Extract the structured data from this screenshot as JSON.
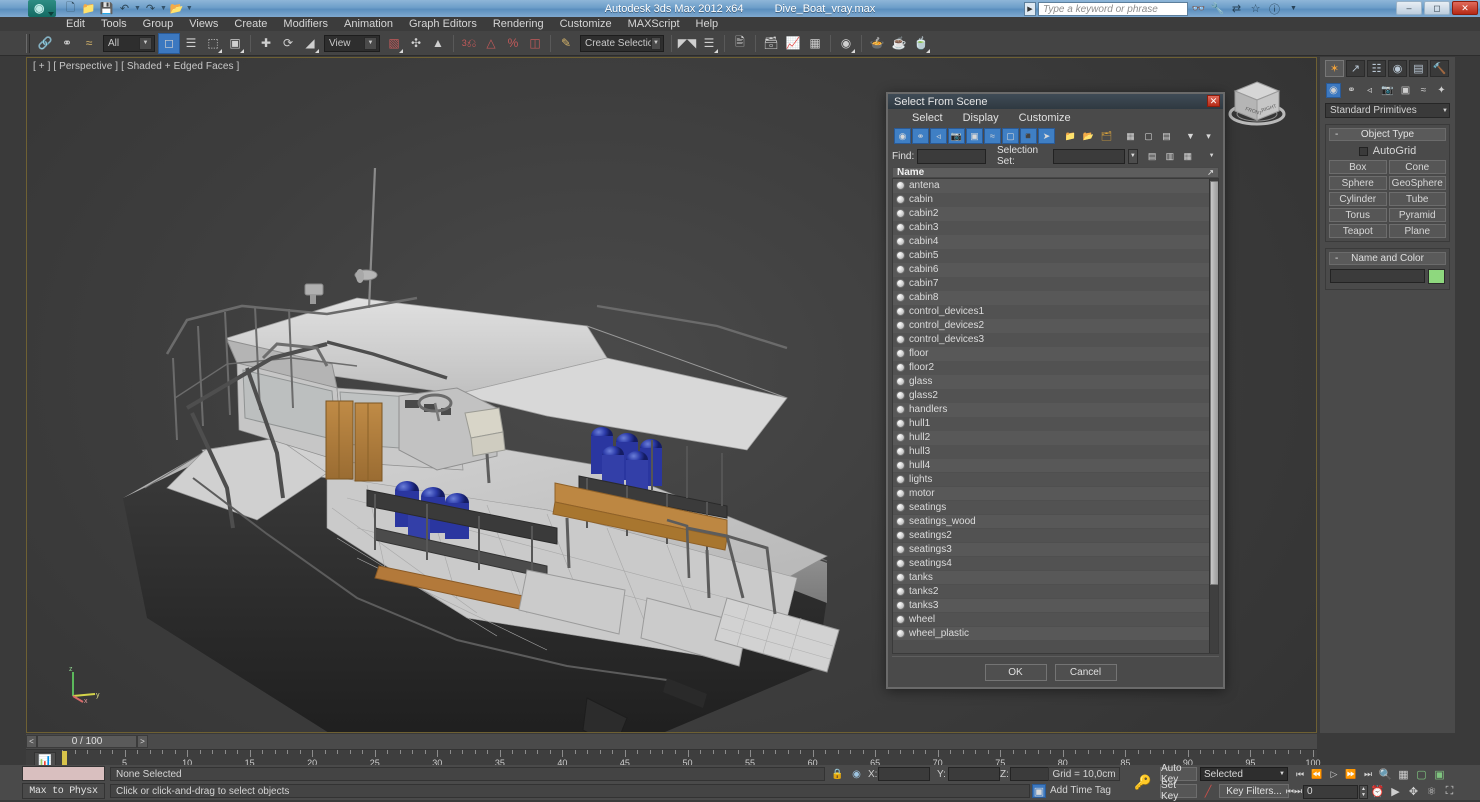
{
  "app": {
    "title_product": "Autodesk 3ds Max  2012 x64",
    "title_file": "Dive_Boat_vray.max",
    "quick_access": [
      "new-icon",
      "open-icon",
      "save-icon",
      "undo-icon",
      "redo-icon",
      "project-icon",
      "qat-overflow-icon"
    ],
    "search_placeholder": "Type a keyword or phrase",
    "help_icons": [
      "binoculars-icon",
      "wrench-icon",
      "exchange-icon",
      "star-icon",
      "help-icon"
    ],
    "window_controls": [
      "minimize",
      "restore",
      "close"
    ]
  },
  "menu": [
    "Edit",
    "Tools",
    "Group",
    "Views",
    "Create",
    "Modifiers",
    "Animation",
    "Graph Editors",
    "Rendering",
    "Customize",
    "MAXScript",
    "Help"
  ],
  "toolbar": {
    "selection_filter": "All",
    "reference_coord": "View",
    "named_selection_set": "Create Selection Se",
    "percent_label": "%",
    "count_label": "3",
    "items": [
      "select-link-icon",
      "unlink-icon",
      "bind-spacewarp-icon",
      "select-object-icon",
      "select-by-name-icon",
      "rectangle-region-icon",
      "window-crossing-icon",
      "select-move-icon",
      "select-rotate-icon",
      "select-scale-icon",
      "mirror-icon",
      "align-icon",
      "layer-manager-icon",
      "curve-editor-icon",
      "schematic-view-icon",
      "material-editor-icon",
      "render-setup-icon",
      "rendered-frame-icon",
      "render-production-icon"
    ]
  },
  "viewport": {
    "label": "[ + ] [ Perspective ] [ Shaded + Edged Faces ]",
    "viewcube": "viewcube-icon",
    "axis_gizmo": "axis-tripod-icon"
  },
  "command_panel": {
    "tabs": [
      "create-tab",
      "modify-tab",
      "hierarchy-tab",
      "motion-tab",
      "display-tab",
      "utilities-tab"
    ],
    "categories": [
      "geometry-icon",
      "shapes-icon",
      "lights-icon",
      "cameras-icon",
      "helpers-icon",
      "spacewarps-icon",
      "systems-icon"
    ],
    "subcategory": "Standard Primitives",
    "rollouts": [
      {
        "title": "Object Type",
        "minus": "-",
        "autogrid_label": "AutoGrid",
        "buttons": [
          "Box",
          "Cone",
          "Sphere",
          "GeoSphere",
          "Cylinder",
          "Tube",
          "Torus",
          "Pyramid",
          "Teapot",
          "Plane"
        ]
      },
      {
        "title": "Name and Color",
        "minus": "-",
        "name_value": "",
        "color_swatch": "#8ed87e"
      }
    ]
  },
  "dialog": {
    "title": "Select From Scene",
    "close_icon": "close-icon",
    "menu": [
      "Select",
      "Display",
      "Customize"
    ],
    "toolbar_icons": [
      "display-geometry-icon",
      "display-shapes-icon",
      "display-lights-icon",
      "display-cameras-icon",
      "display-helpers-icon",
      "display-spacewarps-icon",
      "display-groups-icon",
      "display-xrefs-icon",
      "display-bones-icon",
      "display-children-icon",
      "display-influences-icon",
      "display-frozen-icon",
      "expand-all-icon",
      "collapse-all-icon",
      "select-subtree-icon",
      "filter-icon",
      "filter-advanced-icon"
    ],
    "find_label": "Find:",
    "find_value": "",
    "selection_set_label": "Selection Set:",
    "selection_set_value": "",
    "selset_buttons": [
      "add-selset-icon",
      "remove-selset-icon",
      "edit-selset-icon",
      "overflow-icon"
    ],
    "list_header": "Name",
    "sort_arrow": "sort-ascending-icon",
    "items": [
      "antena",
      "cabin",
      "cabin2",
      "cabin3",
      "cabin4",
      "cabin5",
      "cabin6",
      "cabin7",
      "cabin8",
      "control_devices1",
      "control_devices2",
      "control_devices3",
      "floor",
      "floor2",
      "glass",
      "glass2",
      "handlers",
      "hull1",
      "hull2",
      "hull3",
      "hull4",
      "lights",
      "motor",
      "seatings",
      "seatings_wood",
      "seatings2",
      "seatings3",
      "seatings4",
      "tanks",
      "tanks2",
      "tanks3",
      "wheel",
      "wheel_plastic"
    ],
    "ok_label": "OK",
    "cancel_label": "Cancel"
  },
  "time_slider": {
    "prev_label": "<",
    "next_label": ">",
    "frame_display": "0 / 100",
    "ruler_labels": [
      "5",
      "10",
      "15",
      "20",
      "25",
      "30",
      "35",
      "40",
      "45",
      "50",
      "55",
      "60",
      "65",
      "70",
      "75",
      "80",
      "85",
      "90",
      "95",
      "100"
    ],
    "ruler_max": 100,
    "current_frame": 0
  },
  "status_bar": {
    "max_to_physx": "Max to Physx",
    "prompt_selection": "None Selected",
    "prompt_hint": "Click or click-and-drag to select objects",
    "lock_icon": "lock-icon",
    "iso_icon": "isolate-icon",
    "coord_labels": [
      "X:",
      "Y:",
      "Z:"
    ],
    "coord_values": [
      "",
      "",
      ""
    ],
    "grid_label": "Grid = 10,0cm",
    "add_time_tag": "Add Time Tag",
    "key_icon": "key-icon",
    "auto_key": "Auto Key",
    "set_key": "Set Key",
    "key_mode_value": "Selected",
    "key_filters": "Key Filters...",
    "frame_field_value": "0",
    "playback_icons": [
      "go-to-start-icon",
      "previous-frame-icon",
      "play-icon",
      "next-frame-icon",
      "go-to-end-icon",
      "key-mode-icon"
    ],
    "nav_icons": [
      "zoom-icon",
      "zoom-all-icon",
      "zoom-extents-icon",
      "zoom-extents-all-icon",
      "field-of-view-icon",
      "pan-icon",
      "orbit-icon",
      "maximize-viewport-icon"
    ]
  }
}
